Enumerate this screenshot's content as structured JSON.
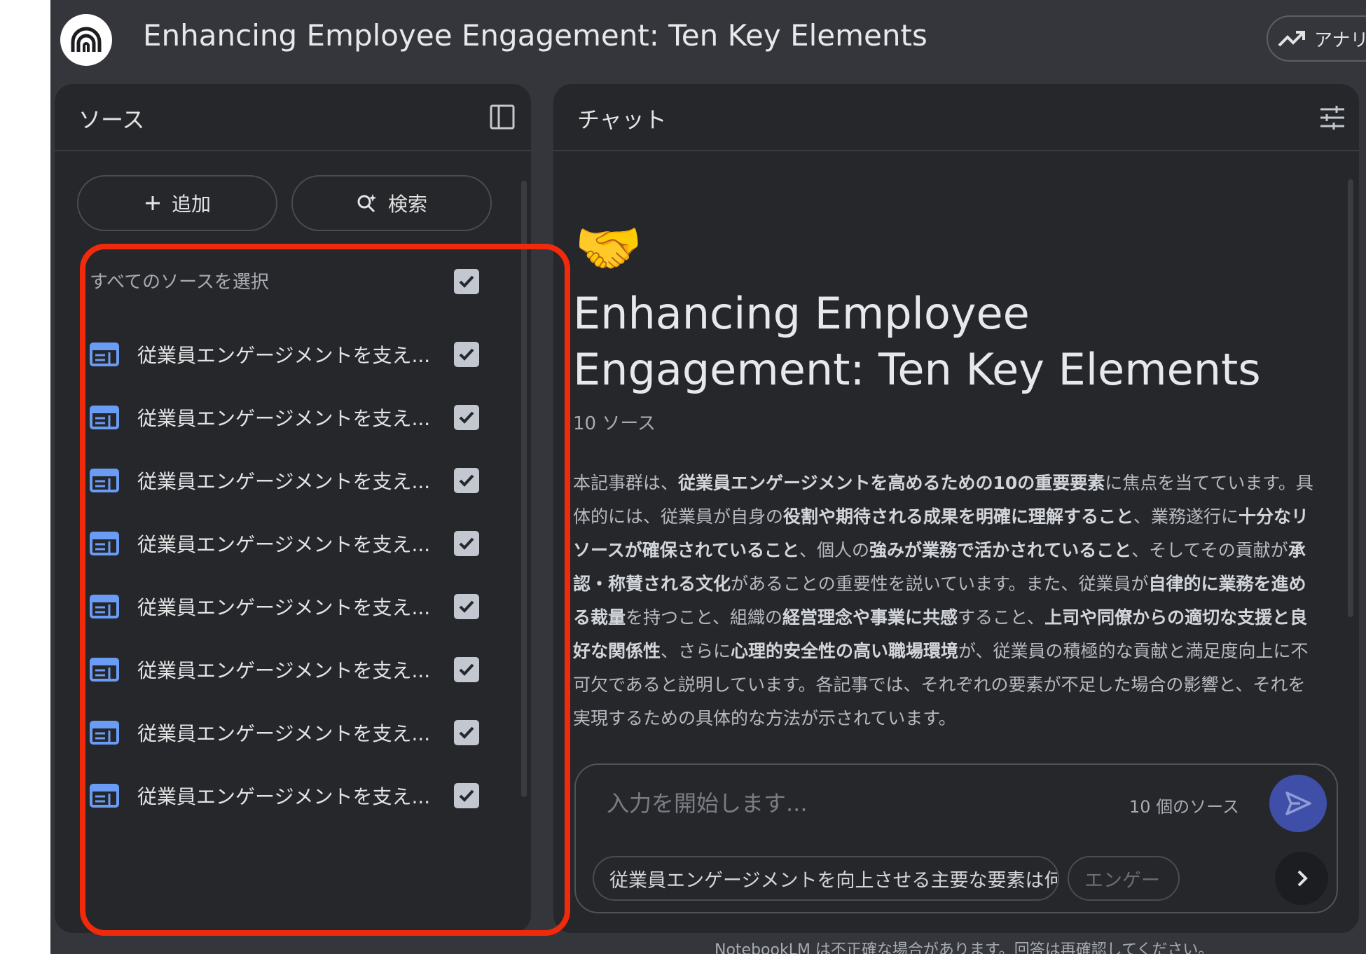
{
  "header": {
    "title": "Enhancing Employee Engagement: Ten Key Elements",
    "analytics_label": "アナリ"
  },
  "sources": {
    "panel_title": "ソース",
    "add_label": "追加",
    "search_label": "検索",
    "select_all_label": "すべてのソースを選択",
    "select_all_checked": true,
    "items": [
      {
        "label": "従業員エンゲージメントを支え...",
        "checked": true
      },
      {
        "label": "従業員エンゲージメントを支え...",
        "checked": true
      },
      {
        "label": "従業員エンゲージメントを支え...",
        "checked": true
      },
      {
        "label": "従業員エンゲージメントを支え...",
        "checked": true
      },
      {
        "label": "従業員エンゲージメントを支え...",
        "checked": true
      },
      {
        "label": "従業員エンゲージメントを支え...",
        "checked": true
      },
      {
        "label": "従業員エンゲージメントを支え...",
        "checked": true
      },
      {
        "label": "従業員エンゲージメントを支え...",
        "checked": true
      }
    ]
  },
  "chat": {
    "panel_title": "チャット",
    "emoji": "🤝",
    "notebook_title": "Enhancing Employee Engagement: Ten Key Elements",
    "source_count": "10 ソース",
    "summary_segments": [
      {
        "text": "本記事群は、",
        "bold": false
      },
      {
        "text": "従業員エンゲージメントを高めるための10の重要要素",
        "bold": true
      },
      {
        "text": "に焦点を当てています。具体的には、従業員が自身の",
        "bold": false
      },
      {
        "text": "役割や期待される成果を明確に理解すること",
        "bold": true
      },
      {
        "text": "、業務遂行に",
        "bold": false
      },
      {
        "text": "十分なリソースが確保されていること",
        "bold": true
      },
      {
        "text": "、個人の",
        "bold": false
      },
      {
        "text": "強みが業務で活かされていること",
        "bold": true
      },
      {
        "text": "、そしてその貢献が",
        "bold": false
      },
      {
        "text": "承認・称賛される文化",
        "bold": true
      },
      {
        "text": "があることの重要性を説いています。また、従業員が",
        "bold": false
      },
      {
        "text": "自律的に業務を進める裁量",
        "bold": true
      },
      {
        "text": "を持つこと、組織の",
        "bold": false
      },
      {
        "text": "経営理念や事業に共感",
        "bold": true
      },
      {
        "text": "すること、",
        "bold": false
      },
      {
        "text": "上司や同僚からの適切な支援と良好な関係性",
        "bold": true
      },
      {
        "text": "、さらに",
        "bold": false
      },
      {
        "text": "心理的安全性の高い職場環境",
        "bold": true
      },
      {
        "text": "が、従業員の積極的な貢献と満足度向上に不可欠であると説明しています。各記事では、それぞれの要素が不足した場合の影響と、それを実現するための具体的な方法が示されています。",
        "bold": false
      }
    ],
    "input_placeholder": "入力を開始します...",
    "input_value": "",
    "composer_source_count": "10 個のソース",
    "suggestions": [
      "従業員エンゲージメントを向上させる主要な要素は何ですか？",
      "エンゲー"
    ],
    "disclaimer": "NotebookLM は不正確な場合があります。回答は再確認してください。"
  },
  "colors": {
    "app_bg": "#34363b",
    "panel_bg": "#25272b",
    "highlight": "#f22a0c",
    "accent": "#3f4fa8",
    "source_icon": "#6a9cf5"
  },
  "icons": {
    "logo": "notebooklm-logo-icon",
    "analytics": "trending-up-icon",
    "collapse": "panel-collapse-icon",
    "tune": "tune-icon",
    "add": "plus-icon",
    "search": "search-sparkle-icon",
    "source": "source-document-icon",
    "check": "check-icon",
    "send": "send-icon",
    "next": "chevron-right-icon"
  }
}
